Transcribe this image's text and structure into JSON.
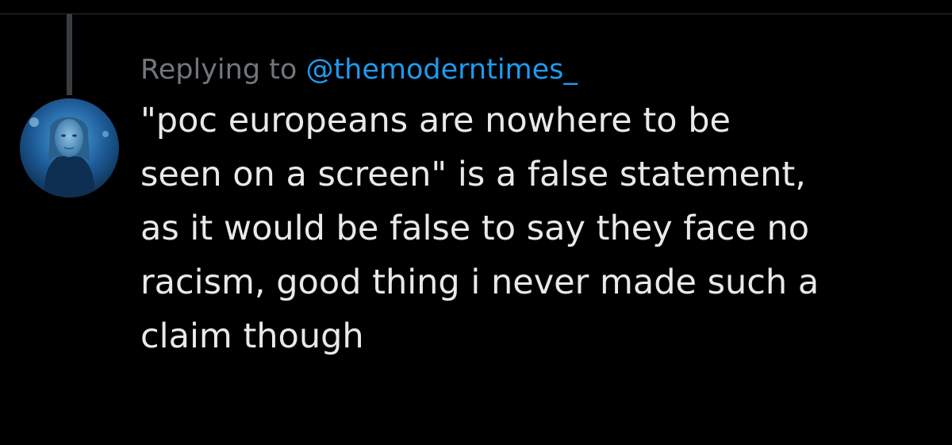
{
  "tweet": {
    "replying_prefix": "Replying to ",
    "replying_handle": "@themoderntimes_",
    "text": "\"poc europeans are nowhere to be\nseen on a screen\" is a false statement,\nas it would be false to say they face no\nracism, good thing i never made such a\nclaim though"
  },
  "colors": {
    "background": "#000000",
    "text": "#e7e9ea",
    "muted": "#71767b",
    "mention": "#1d9bf0",
    "thread_line": "#3a3d40"
  }
}
